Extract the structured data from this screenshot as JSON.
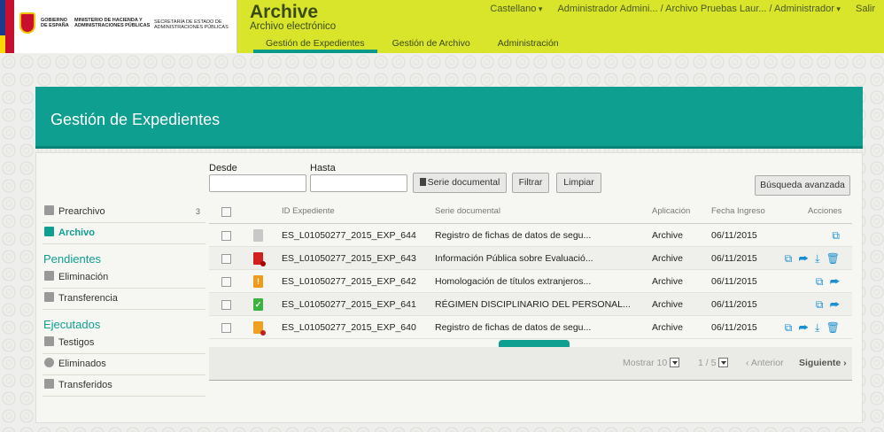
{
  "header": {
    "gov_logo_text_1": "Gobierno de España",
    "gov_logo_text_2": "Ministerio de Hacienda y Administraciones Públicas",
    "gov_logo_text_3": "Secretaría de Estado de Administraciones Públicas",
    "app_title": "Archive",
    "app_subtitle": "Archivo electrónico",
    "language": "Castellano",
    "user_context": "Administrador Admini... / Archivo Pruebas Laur... / Administrador",
    "logout": "Salir",
    "nav": [
      {
        "label": "Gestión de Expedientes",
        "active": true
      },
      {
        "label": "Gestión de Archivo",
        "active": false
      },
      {
        "label": "Administración",
        "active": false
      }
    ]
  },
  "panel": {
    "title": "Gestión de Expedientes"
  },
  "sidebar": {
    "prearchivo": {
      "label": "Prearchivo",
      "count": "3"
    },
    "archivo": {
      "label": "Archivo"
    },
    "pendientes_title": "Pendientes",
    "eliminacion": {
      "label": "Eliminación"
    },
    "transferencia": {
      "label": "Transferencia"
    },
    "ejecutados_title": "Ejecutados",
    "testigos": {
      "label": "Testigos"
    },
    "eliminados": {
      "label": "Eliminados"
    },
    "transferidos": {
      "label": "Transferidos"
    }
  },
  "filters": {
    "desde_label": "Desde",
    "hasta_label": "Hasta",
    "desde_value": "",
    "hasta_value": "",
    "serie_button": "Serie documental",
    "filtrar_button": "Filtrar",
    "limpiar_button": "Limpiar",
    "advanced_button": "Búsqueda avanzada"
  },
  "table": {
    "columns": {
      "id": "ID Expediente",
      "serie": "Serie documental",
      "aplicacion": "Aplicación",
      "fecha": "Fecha Ingreso",
      "acciones": "Acciones"
    },
    "rows": [
      {
        "id": "ES_L01050277_2015_EXP_644",
        "serie": "Registro de fichas de datos de segu...",
        "aplicacion": "Archive",
        "fecha": "06/11/2015",
        "status_icon": "file-gray-icon",
        "status_color": "#c8c8c8",
        "actions": "⧉"
      },
      {
        "id": "ES_L01050277_2015_EXP_643",
        "serie": "Información Pública sobre Evaluació...",
        "aplicacion": "Archive",
        "fecha": "06/11/2015",
        "status_icon": "file-error-icon",
        "status_color": "#d02020",
        "actions": "⧉ ➦ ⤓ 🗑"
      },
      {
        "id": "ES_L01050277_2015_EXP_642",
        "serie": "Homologación de títulos extranjeros...",
        "aplicacion": "Archive",
        "fecha": "06/11/2015",
        "status_icon": "warning-icon",
        "status_color": "#f09a1a",
        "actions": "⧉ ➦"
      },
      {
        "id": "ES_L01050277_2015_EXP_641",
        "serie": "RÉGIMEN DISCIPLINARIO DEL PERSONAL...",
        "aplicacion": "Archive",
        "fecha": "06/11/2015",
        "status_icon": "check-icon",
        "status_color": "#3cb340",
        "actions": "⧉ ➦"
      },
      {
        "id": "ES_L01050277_2015_EXP_640",
        "serie": "Registro de fichas de datos de segu...",
        "aplicacion": "Archive",
        "fecha": "06/11/2015",
        "status_icon": "file-orange-error-icon",
        "status_color": "#f0a020",
        "actions": "⧉ ➦ ⤓ 🗑"
      }
    ]
  },
  "pager": {
    "mostrar_label": "Mostrar",
    "page_size": "10",
    "page_info": "1 / 5",
    "prev": "‹ Anterior",
    "next": "Siguiente ›"
  },
  "colors": {
    "brand_lime": "#d8e52a",
    "accent_teal": "#0e9f90",
    "action_blue": "#1a8fd0"
  }
}
